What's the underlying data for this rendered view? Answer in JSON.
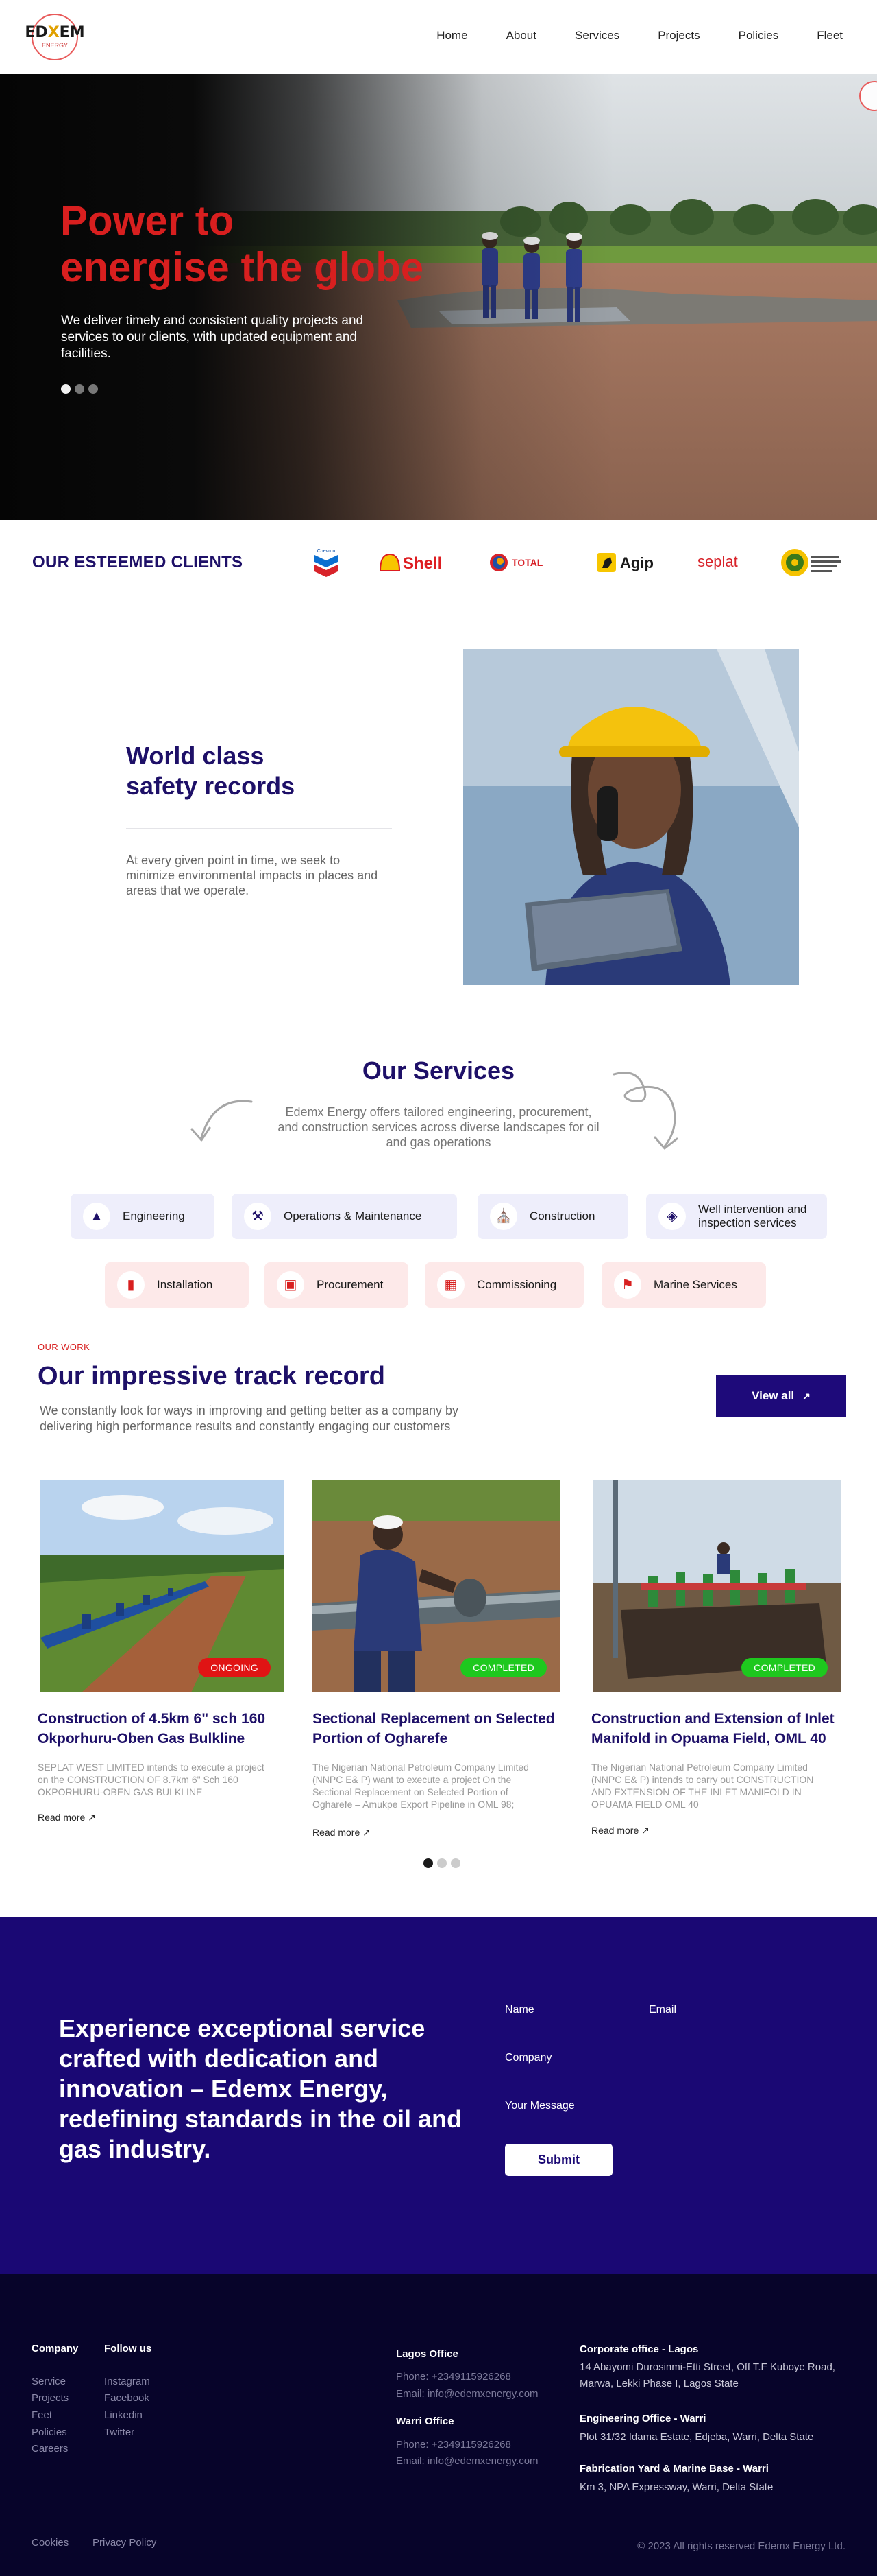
{
  "header": {
    "logo": {
      "mark": "EDXEM",
      "sub": "ENERGY"
    },
    "nav": [
      "Home",
      "About",
      "Services",
      "Projects",
      "Policies",
      "Fleet"
    ]
  },
  "hero": {
    "title_line1": "Power to",
    "title_line2": "energise the globe",
    "text": "We deliver timely and consistent quality projects and services to our clients, with updated equipment and facilities.",
    "slides": 3,
    "active_slide": 1
  },
  "clients": {
    "title": "OUR ESTEEMED CLIENTS",
    "logos": [
      {
        "name": "Chevron",
        "color": "#0b4fa8"
      },
      {
        "name": "Shell",
        "color": "#dd1d21"
      },
      {
        "name": "TOTAL",
        "color": "#d8232a"
      },
      {
        "name": "Agip",
        "color": "#1a1a1a"
      },
      {
        "name": "seplat",
        "color": "#d8232a"
      },
      {
        "name": "Nigerian Petroleum Development Company",
        "color": "#3a7a1a"
      }
    ]
  },
  "safety": {
    "title_line1": "World class",
    "title_line2": "safety records",
    "text": "At every given point in time, we seek to minimize environmental impacts in places and areas that we operate."
  },
  "services": {
    "title": "Our Services",
    "description": "Edemx Energy offers tailored engineering, procurement, and construction services across diverse landscapes for oil and gas operations",
    "row1": [
      {
        "label": "Engineering",
        "icon": "hard-hat-icon"
      },
      {
        "label": "Operations & Maintenance",
        "icon": "tools-icon"
      },
      {
        "label": "Construction",
        "icon": "construction-icon"
      },
      {
        "label": "Well intervention and inspection services",
        "icon": "well-icon"
      }
    ],
    "row2": [
      {
        "label": "Installation",
        "icon": "installation-icon"
      },
      {
        "label": "Procurement",
        "icon": "procurement-icon"
      },
      {
        "label": "Commissioning",
        "icon": "commissioning-icon"
      },
      {
        "label": "Marine Services",
        "icon": "marine-icon"
      }
    ]
  },
  "work": {
    "kicker": "OUR WORK",
    "title": "Our impressive track record",
    "description": "We constantly look for ways in improving and getting better as a company by delivering high performance results and constantly engaging our customers",
    "view_all": "View all",
    "projects": [
      {
        "status": "ONGOING",
        "title": "Construction of 4.5km 6\" sch 160 Okporhuru-Oben Gas Bulkline",
        "text": "SEPLAT WEST LIMITED intends to execute a project on the CONSTRUCTION OF 8.7km 6\" Sch 160 OKPORHURU-OBEN GAS BULKLINE",
        "read_more": "Read  more"
      },
      {
        "status": "COMPLETED",
        "title": "Sectional Replacement on Selected Portion of Ogharefe",
        "text": "The Nigerian National Petroleum Company Limited (NNPC E& P) want to execute a project On the Sectional Replacement on Selected Portion of Ogharefe – Amukpe Export Pipeline in OML 98;",
        "read_more": "Read  more"
      },
      {
        "status": "COMPLETED",
        "title": "Construction and Extension of Inlet Manifold in Opuama Field, OML 40",
        "text": "The Nigerian National Petroleum Company Limited (NNPC E& P) intends to carry out CONSTRUCTION AND EXTENSION OF THE INLET MANIFOLD IN OPUAMA FIELD OML 40",
        "read_more": "Read  more"
      }
    ],
    "pages": 3,
    "active_page": 1
  },
  "cta": {
    "text": "Experience exceptional service crafted with dedication and innovation – Edemx Energy, redefining standards in the oil and gas industry.",
    "name_label": "Name",
    "email_label": "Email",
    "company_label": "Company",
    "message_label": "Your Message",
    "submit": "Submit"
  },
  "footer": {
    "company_head": "Company",
    "company_links": [
      "Service",
      "Projects",
      "Feet",
      "Policies",
      "Careers"
    ],
    "follow_head": "Follow us",
    "follow_links": [
      "Instagram",
      "Facebook",
      "Linkedin",
      "Twitter"
    ],
    "lagos_head": "Lagos Office",
    "lagos_phone": "Phone: +2349115926268",
    "lagos_email": "Email: info@edemxenergy.com",
    "warri_head": "Warri Office",
    "warri_phone": "Phone: +2349115926268",
    "warri_email": "Email: info@edemxenergy.com",
    "corporate_head": "Corporate office - Lagos",
    "corporate_addr": "14 Abayomi Durosinmi-Etti Street, Off T.F Kuboye Road, Marwa, Lekki Phase I, Lagos State",
    "eng_head": "Engineering Office - Warri",
    "eng_addr": "Plot 31/32 Idama Estate, Edjeba, Warri, Delta State",
    "fab_head": "Fabrication Yard & Marine Base - Warri",
    "fab_addr": "Km 3, NPA Expressway, Warri, Delta State",
    "cookies": "Cookies",
    "privacy": "Privacy Policy",
    "copyright": "© 2023 All rights reserved Edemx Energy Ltd."
  }
}
